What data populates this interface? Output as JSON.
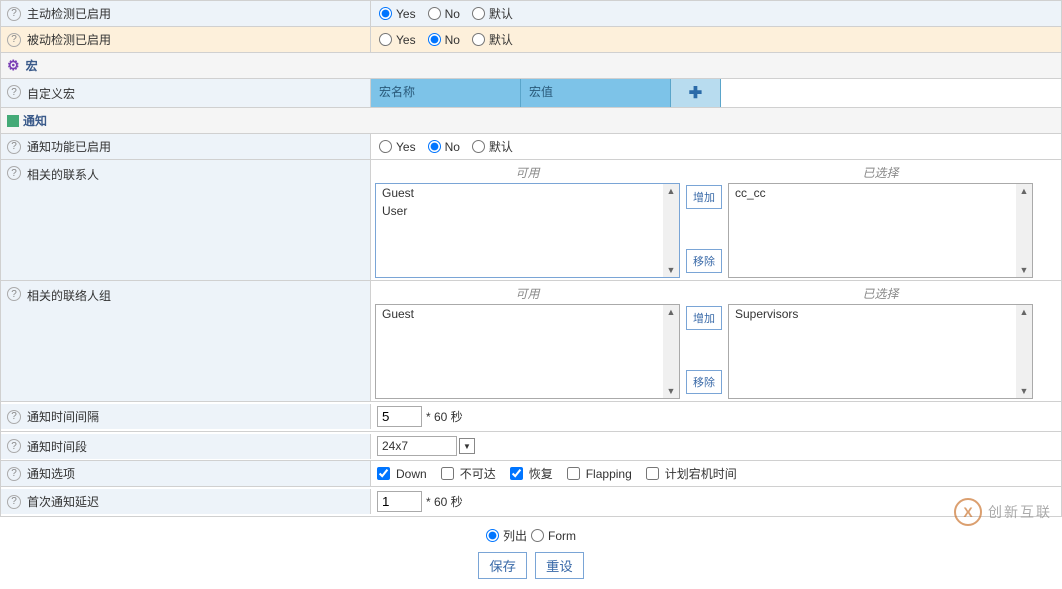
{
  "rows": {
    "active_check": {
      "label": "主动检测已启用",
      "yes": "Yes",
      "no": "No",
      "default": "默认"
    },
    "passive_check": {
      "label": "被动检测已启用",
      "yes": "Yes",
      "no": "No",
      "default": "默认"
    }
  },
  "macro_section": {
    "title": "宏",
    "custom_label": "自定义宏",
    "col_name": "宏名称",
    "col_value": "宏值"
  },
  "notification_section": {
    "title": "通知",
    "enabled": {
      "label": "通知功能已启用",
      "yes": "Yes",
      "no": "No",
      "default": "默认"
    },
    "contacts": {
      "label": "相关的联系人",
      "available_header": "可用",
      "selected_header": "已选择",
      "available_items": [
        "Guest",
        "User"
      ],
      "selected_items": [
        "cc_cc"
      ],
      "add_btn": "增加",
      "remove_btn": "移除"
    },
    "contact_groups": {
      "label": "相关的联络人组",
      "available_header": "可用",
      "selected_header": "已选择",
      "available_items": [
        "Guest"
      ],
      "selected_items": [
        "Supervisors"
      ],
      "add_btn": "增加",
      "remove_btn": "移除"
    },
    "interval": {
      "label": "通知时间间隔",
      "value": "5",
      "suffix": "* 60 秒"
    },
    "timeperiod": {
      "label": "通知时间段",
      "value": "24x7"
    },
    "options": {
      "label": "通知选项",
      "down": "Down",
      "unreachable": "不可达",
      "recovery": "恢复",
      "flapping": "Flapping",
      "downtime": "计划宕机时间"
    },
    "first_delay": {
      "label": "首次通知延迟",
      "value": "1",
      "suffix": "* 60 秒"
    }
  },
  "footer": {
    "list": "列出",
    "form": "Form",
    "save": "保存",
    "reset": "重设"
  },
  "watermark": {
    "logo": "X",
    "text": "创新互联"
  }
}
